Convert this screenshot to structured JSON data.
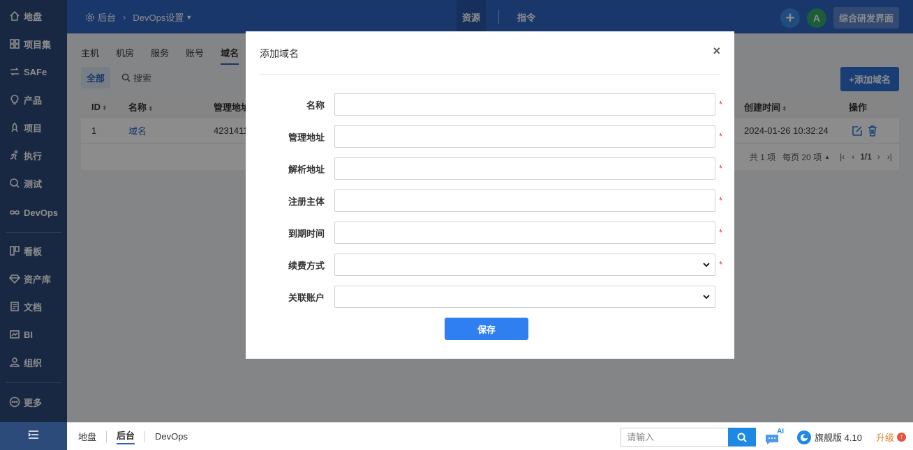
{
  "sidebar": {
    "items": [
      {
        "label": "地盘",
        "icon": "home-icon"
      },
      {
        "label": "项目集",
        "icon": "grid-icon"
      },
      {
        "label": "SAFe",
        "icon": "safe-icon"
      },
      {
        "label": "产品",
        "icon": "lightbulb-icon"
      },
      {
        "label": "项目",
        "icon": "rocket-icon"
      },
      {
        "label": "执行",
        "icon": "run-icon"
      },
      {
        "label": "测试",
        "icon": "magnifier-icon"
      },
      {
        "label": "DevOps",
        "icon": "infinity-icon"
      },
      {
        "label": "看板",
        "icon": "kanban-icon"
      },
      {
        "label": "资产库",
        "icon": "diamond-icon"
      },
      {
        "label": "文档",
        "icon": "document-icon"
      },
      {
        "label": "BI",
        "icon": "chart-icon"
      },
      {
        "label": "组织",
        "icon": "people-icon"
      },
      {
        "label": "更多",
        "icon": "more-icon"
      }
    ]
  },
  "header": {
    "crumb_root": "后台",
    "crumb_current": "DevOps设置",
    "tab_resources": "资源",
    "tab_commands": "指令",
    "avatar_letter": "A",
    "rd_button": "综合研发界面"
  },
  "subtabs": [
    "主机",
    "机房",
    "服务",
    "账号",
    "域名"
  ],
  "filter": {
    "all": "全部",
    "search": "搜索"
  },
  "add_domain_button": "+添加域名",
  "table": {
    "headers": {
      "id": "ID",
      "name": "名称",
      "manage": "管理地址",
      "created": "创建时间",
      "actions": "操作"
    },
    "rows": [
      {
        "id": "1",
        "name": "域名",
        "manage": "4231411",
        "created": "2024-01-26 10:32:24"
      }
    ],
    "footer": {
      "total": "共 1 项",
      "per_page": "每页 20 项",
      "pages": "1/1"
    }
  },
  "modal": {
    "title": "添加域名",
    "close": "×",
    "fields": [
      {
        "label": "名称",
        "type": "input",
        "value": "",
        "required": true
      },
      {
        "label": "管理地址",
        "type": "input",
        "value": "",
        "required": true
      },
      {
        "label": "解析地址",
        "type": "input",
        "value": "",
        "required": true
      },
      {
        "label": "注册主体",
        "type": "input",
        "value": "",
        "required": true
      },
      {
        "label": "到期时间",
        "type": "input",
        "value": "",
        "required": true
      },
      {
        "label": "续费方式",
        "type": "select",
        "value": "",
        "required": true
      },
      {
        "label": "关联账户",
        "type": "select",
        "value": "",
        "required": false
      }
    ],
    "required_mark": "*",
    "save": "保存"
  },
  "bottombar": {
    "crumbs": [
      "地盘",
      "后台",
      "DevOps"
    ],
    "search_placeholder": "请输入",
    "ai_label": "AI",
    "edition": "旗舰版 4.10",
    "upgrade": "升级",
    "upgrade_badge": "↑"
  },
  "colors": {
    "sidebar_bg": "#2c4a7a",
    "header_bg": "#2f64c2",
    "primary": "#2f7ff0",
    "required": "#e53935"
  }
}
